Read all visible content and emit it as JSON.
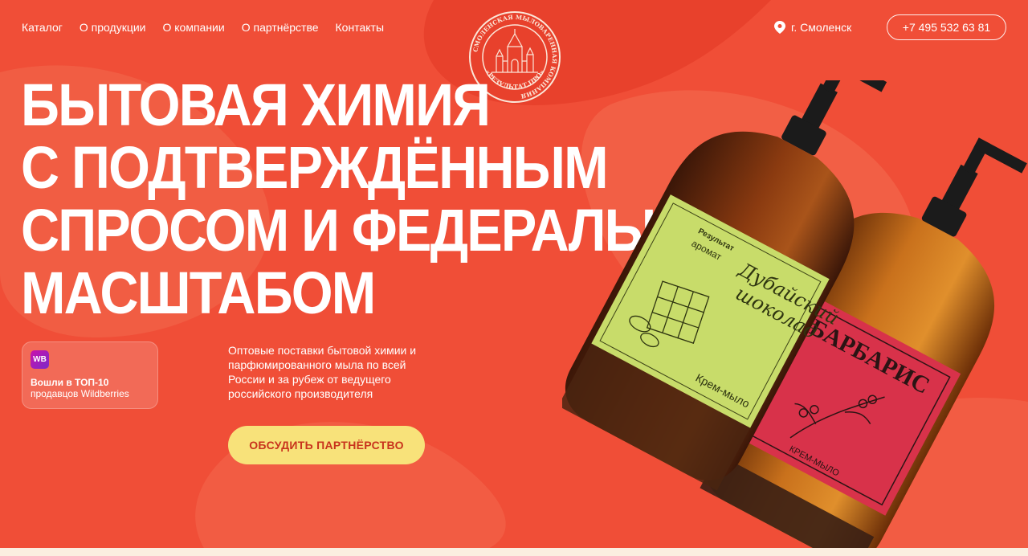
{
  "nav": {
    "items": [
      "Каталог",
      "О продукции",
      "О компании",
      "О партнёрстве",
      "Контакты"
    ]
  },
  "logo": {
    "ring_text": "СМОЛЕНСКАЯ МЫЛОВАРЕННАЯ КОМПАНИЯ",
    "name": "«РЕЗУЛЬТАТ.ПРО»"
  },
  "header": {
    "city": "г. Смоленск",
    "phone": "+7 495 532 63 81"
  },
  "hero": {
    "title_lines": [
      "Бытовая химия",
      "с подтверждённым",
      "спросом и федеральным",
      "масштабом"
    ],
    "description": "Оптовые поставки бытовой химии и парфюмированного мыла по всей России и за рубеж от ведущего российского производителя",
    "cta_label": "ОБСУДИТЬ ПАРТНЁРСТВО"
  },
  "wb_card": {
    "badge": "WB",
    "line1": "Вошли в ТОП-10",
    "line2": "продавцов Wildberries"
  },
  "products": {
    "green": {
      "brand": "Результат",
      "aroma": "аромат",
      "name_1": "Дубайский",
      "name_2": "шоколад",
      "type": "Крем-мыло"
    },
    "red": {
      "name": "БАРБАРИС",
      "type": "КРЕМ-МЫЛО"
    }
  },
  "colors": {
    "background": "#f04e37",
    "background_light": "#f36a4f",
    "cta_bg": "#f8e27a",
    "cta_text": "#c8331d",
    "wb_purple": "#cb11ab"
  }
}
